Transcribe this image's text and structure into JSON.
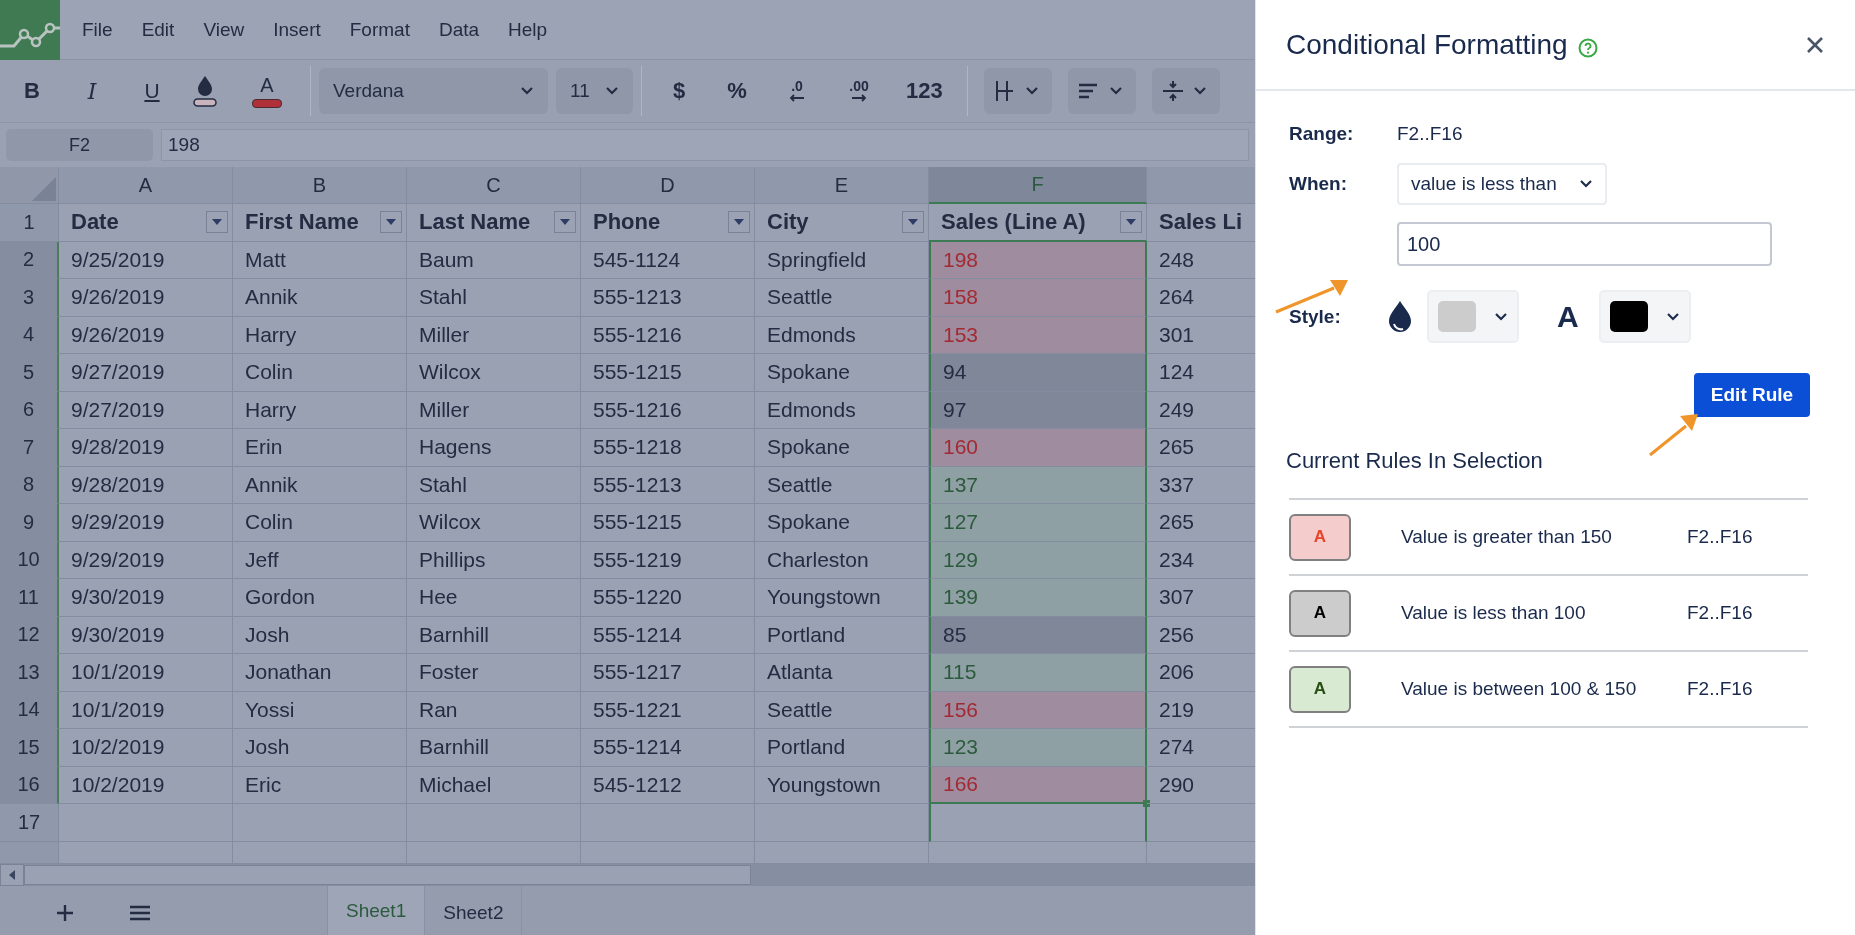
{
  "menu": [
    "File",
    "Edit",
    "View",
    "Insert",
    "Format",
    "Data",
    "Help"
  ],
  "toolbar": {
    "format_buttons": [
      {
        "kind": "bold",
        "label": "B"
      },
      {
        "kind": "italic",
        "label": "I"
      },
      {
        "kind": "underline",
        "label": "U"
      },
      {
        "kind": "fill"
      },
      {
        "kind": "text-color",
        "label": "A"
      }
    ],
    "font": "Verdana",
    "size": "11",
    "number_buttons": [
      {
        "kind": "text",
        "label": "$"
      },
      {
        "kind": "text",
        "label": "%"
      },
      {
        "kind": "decimal-decrease",
        "label": ".0"
      },
      {
        "kind": "decimal-increase",
        "label": ".00"
      },
      {
        "kind": "text",
        "label": "123"
      }
    ],
    "layout_dropdowns": [
      {
        "kind": "borders"
      },
      {
        "kind": "align"
      },
      {
        "kind": "valign"
      }
    ]
  },
  "formula_bar": {
    "cell": "F2",
    "value": "198"
  },
  "columns": [
    {
      "letter": "A",
      "selected": false
    },
    {
      "letter": "B",
      "selected": false
    },
    {
      "letter": "C",
      "selected": false
    },
    {
      "letter": "D",
      "selected": false
    },
    {
      "letter": "E",
      "selected": false
    },
    {
      "letter": "F",
      "selected": true
    }
  ],
  "header_row": {
    "num": "1",
    "cells": [
      "Date",
      "First Name",
      "Last Name",
      "Phone",
      "City",
      "Sales (Line A)",
      "Sales Li"
    ]
  },
  "rows": [
    {
      "num": "2",
      "selected": true,
      "kind": "high",
      "cells": [
        "9/25/2019",
        "Matt",
        "Baum",
        "545-1124",
        "Springfield",
        "198",
        "248"
      ]
    },
    {
      "num": "3",
      "selected": true,
      "kind": "high",
      "cells": [
        "9/26/2019",
        "Annik",
        "Stahl",
        "555-1213",
        "Seattle",
        "158",
        "264"
      ]
    },
    {
      "num": "4",
      "selected": true,
      "kind": "high",
      "cells": [
        "9/26/2019",
        "Harry",
        "Miller",
        "555-1216",
        "Edmonds",
        "153",
        "301"
      ]
    },
    {
      "num": "5",
      "selected": true,
      "kind": "low",
      "cells": [
        "9/27/2019",
        "Colin",
        "Wilcox",
        "555-1215",
        "Spokane",
        "94",
        "124"
      ]
    },
    {
      "num": "6",
      "selected": true,
      "kind": "low",
      "cells": [
        "9/27/2019",
        "Harry",
        "Miller",
        "555-1216",
        "Edmonds",
        "97",
        "249"
      ]
    },
    {
      "num": "7",
      "selected": true,
      "kind": "high",
      "cells": [
        "9/28/2019",
        "Erin",
        "Hagens",
        "555-1218",
        "Spokane",
        "160",
        "265"
      ]
    },
    {
      "num": "8",
      "selected": true,
      "kind": "mid",
      "cells": [
        "9/28/2019",
        "Annik",
        "Stahl",
        "555-1213",
        "Seattle",
        "137",
        "337"
      ]
    },
    {
      "num": "9",
      "selected": true,
      "kind": "mid",
      "cells": [
        "9/29/2019",
        "Colin",
        "Wilcox",
        "555-1215",
        "Spokane",
        "127",
        "265"
      ]
    },
    {
      "num": "10",
      "selected": true,
      "kind": "mid",
      "cells": [
        "9/29/2019",
        "Jeff",
        "Phillips",
        "555-1219",
        "Charleston",
        "129",
        "234"
      ]
    },
    {
      "num": "11",
      "selected": true,
      "kind": "mid",
      "cells": [
        "9/30/2019",
        "Gordon",
        "Hee",
        "555-1220",
        "Youngstown",
        "139",
        "307"
      ]
    },
    {
      "num": "12",
      "selected": true,
      "kind": "low",
      "cells": [
        "9/30/2019",
        "Josh",
        "Barnhill",
        "555-1214",
        "Portland",
        "85",
        "256"
      ]
    },
    {
      "num": "13",
      "selected": true,
      "kind": "mid",
      "cells": [
        "10/1/2019",
        "Jonathan",
        "Foster",
        "555-1217",
        "Atlanta",
        "115",
        "206"
      ]
    },
    {
      "num": "14",
      "selected": true,
      "kind": "high",
      "cells": [
        "10/1/2019",
        "Yossi",
        "Ran",
        "555-1221",
        "Seattle",
        "156",
        "219"
      ]
    },
    {
      "num": "15",
      "selected": true,
      "kind": "mid",
      "cells": [
        "10/2/2019",
        "Josh",
        "Barnhill",
        "555-1214",
        "Portland",
        "123",
        "274"
      ]
    },
    {
      "num": "16",
      "selected": true,
      "kind": "high",
      "cells": [
        "10/2/2019",
        "Eric",
        "Michael",
        "545-1212",
        "Youngstown",
        "166",
        "290"
      ]
    },
    {
      "num": "17",
      "selected": false,
      "kind": "none",
      "cells": [
        "",
        "",
        "",
        "",
        "",
        "",
        ""
      ]
    }
  ],
  "sheets": [
    {
      "label": "Sheet1",
      "selected": true
    },
    {
      "label": "Sheet2",
      "selected": false
    }
  ],
  "panel": {
    "title": "Conditional Formatting",
    "range_label": "Range:",
    "range": "F2..F16",
    "when_label": "When:",
    "condition": "value is less than",
    "value": "100",
    "style_label": "Style:",
    "text_color_label": "A",
    "button": "Edit Rule",
    "rules_heading": "Current Rules In Selection",
    "rules": [
      {
        "kind": "high",
        "swatch": "A",
        "text": "Value is greater than 150",
        "range": "F2..F16"
      },
      {
        "kind": "low",
        "swatch": "A",
        "text": "Value is less than 100",
        "range": "F2..F16"
      },
      {
        "kind": "mid",
        "swatch": "A",
        "text": "Value is between 100 & 150",
        "range": "F2..F16"
      }
    ]
  }
}
